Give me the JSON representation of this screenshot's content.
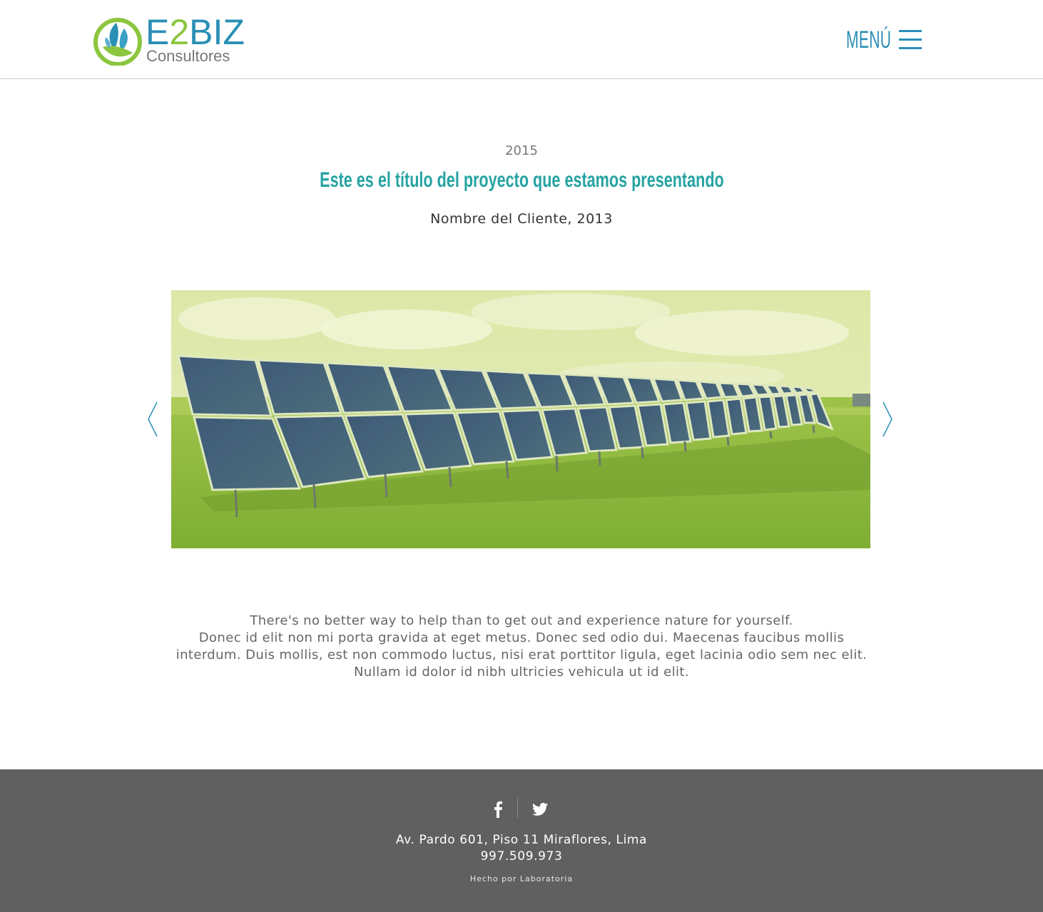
{
  "header": {
    "logo": {
      "word_left": "E",
      "word_mid": "2",
      "word_right": "BIZ",
      "subtitle": "Consultores"
    },
    "menu_label": "MENÚ"
  },
  "project": {
    "year": "2015",
    "title": "Este es el título del proyecto que estamos presentando",
    "client": "Nombre del Cliente, 2013"
  },
  "carousel": {
    "image": "solar-panels-field",
    "prev_icon": "chevron-left-icon",
    "next_icon": "chevron-right-icon"
  },
  "description": {
    "line1": "There's no better way to help than to get out and experience nature for yourself.",
    "line2": "Donec id elit non mi porta gravida at eget metus. Donec sed odio dui. Maecenas faucibus mollis interdum. Duis mollis, est non commodo luctus, nisi erat porttitor ligula, eget lacinia odio sem nec elit. Nullam id dolor id nibh ultricies vehicula ut id elit."
  },
  "footer": {
    "address": "Av. Pardo 601, Piso 11 Miraflores, Lima",
    "phone": "997.509.973",
    "credit": "Hecho por Laboratoria",
    "social": [
      "facebook-icon",
      "twitter-icon"
    ]
  },
  "colors": {
    "brand_blue": "#2a8fb5",
    "brand_green": "#8cc63e",
    "title_teal": "#27a3a3",
    "footer_bg": "#606060"
  }
}
